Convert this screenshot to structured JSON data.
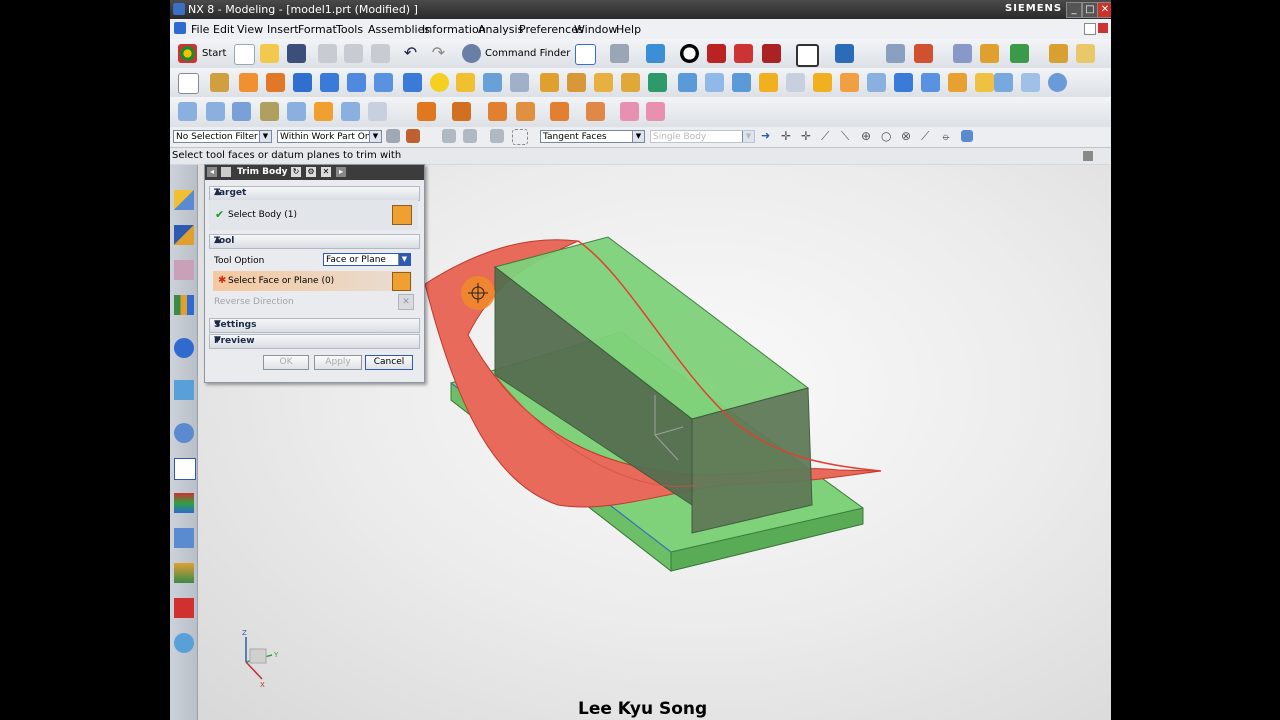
{
  "window": {
    "title": "NX 8 - Modeling - [model1.prt (Modified) ]",
    "brand": "SIEMENS",
    "controls": [
      "_",
      "□",
      "✕"
    ]
  },
  "menu": [
    "File",
    "Edit",
    "View",
    "Insert",
    "Format",
    "Tools",
    "Assemblies",
    "Information",
    "Analysis",
    "Preferences",
    "Window",
    "Help"
  ],
  "toolbar": {
    "start_label": "Start",
    "command_finder_label": "Command Finder"
  },
  "selection_bar": {
    "type_filter": "No Selection Filter",
    "scope": "Within Work Part Only",
    "face_rule": "Tangent Faces",
    "body_rule": "Single Body"
  },
  "cue_line": "Select tool faces or datum planes to trim with",
  "dialog": {
    "title": "Trim Body",
    "target_header": "Target",
    "select_body": "Select Body (1)",
    "tool_header": "Tool",
    "tool_option_label": "Tool Option",
    "tool_option_value": "Face or Plane",
    "select_face": "Select Face or Plane (0)",
    "reverse_direction": "Reverse Direction",
    "settings_header": "Settings",
    "preview_header": "Preview",
    "ok": "OK",
    "apply": "Apply",
    "cancel": "Cancel"
  },
  "csys_labels": {
    "x": "X",
    "y": "Y",
    "z": "Z"
  },
  "watermark": "Lee Kyu Song",
  "colors": {
    "body_green": "#7fd27a",
    "body_dark": "#566e50",
    "sheet_red": "#e86a5a",
    "highlight_orange": "#f08a28",
    "accent_blue": "#1f5fb8"
  }
}
